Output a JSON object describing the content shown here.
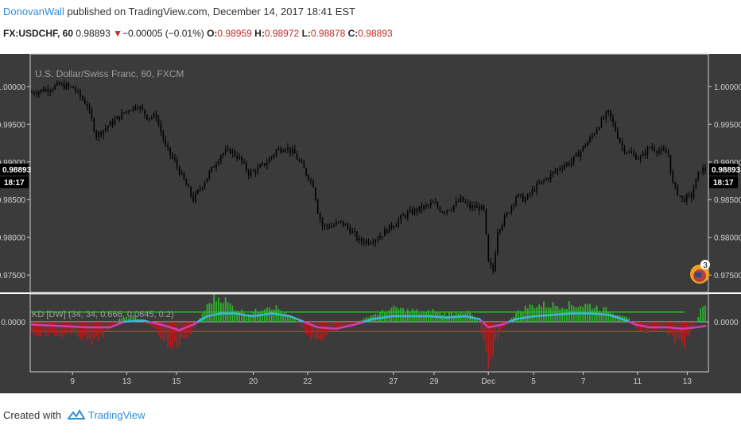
{
  "header": {
    "author": "DonovanWall",
    "published_text": " published on TradingView.com, December 14, 2017 18:41 EST"
  },
  "quote": {
    "symbol": "FX:USDCHF, 60",
    "last": "0.98893",
    "change": "−0.00005 (−0.01%)",
    "open_label": "O:",
    "open": "0.98959",
    "high_label": "H:",
    "high": "0.98972",
    "low_label": "L:",
    "low": "0.98878",
    "close_label": "C:",
    "close": "0.98893"
  },
  "colors": {
    "panel_bg": "#3b3b3b",
    "candle": "#000000",
    "histogram_pos": "#2db52d",
    "histogram_neg": "#b71c1c",
    "line_pos": "#3fb6d8",
    "line_neg": "#d63ab0",
    "upper_band": "#22c322",
    "lower_band": "#d32f2f",
    "price_tag_bg": "#000000",
    "brand": "#2f8fd8"
  },
  "footer": {
    "created_with": "Created with",
    "brand": "TradingView"
  },
  "chart_data": [
    {
      "type": "candlestick",
      "title": "U.S. Dollar/Swiss Franc, 60, FXCM",
      "yticks": [
        "1.00000",
        "0.99500",
        "0.99000",
        "0.98500",
        "0.98000",
        "0.97500"
      ],
      "ylim": [
        0.9727,
        1.0043
      ],
      "last_price_label": "0.98893",
      "countdown_label": "18:17",
      "badge_label": "3",
      "x_ticks": [
        "9",
        "13",
        "15",
        "20",
        "22",
        "27",
        "29",
        "Dec",
        "5",
        "7",
        "11",
        "13"
      ],
      "close_path": [
        [
          0,
          0.9992
        ],
        [
          3,
          0.9996
        ],
        [
          6,
          1.0002
        ],
        [
          9,
          0.9998
        ],
        [
          12,
          0.9975
        ],
        [
          14,
          0.9935
        ],
        [
          17,
          0.995
        ],
        [
          19,
          0.996
        ],
        [
          21,
          0.997
        ],
        [
          23,
          0.9975
        ],
        [
          25,
          0.996
        ],
        [
          27,
          0.996
        ],
        [
          29,
          0.992
        ],
        [
          31,
          0.99
        ],
        [
          33,
          0.9875
        ],
        [
          35,
          0.985
        ],
        [
          37,
          0.987
        ],
        [
          39,
          0.989
        ],
        [
          41,
          0.991
        ],
        [
          43,
          0.9915
        ],
        [
          45,
          0.9905
        ],
        [
          47,
          0.9885
        ],
        [
          49,
          0.989
        ],
        [
          51,
          0.99
        ],
        [
          53,
          0.9915
        ],
        [
          55,
          0.992
        ],
        [
          57,
          0.991
        ],
        [
          59,
          0.989
        ],
        [
          61,
          0.987
        ],
        [
          62,
          0.9835
        ],
        [
          63,
          0.9815
        ],
        [
          65,
          0.9815
        ],
        [
          67,
          0.982
        ],
        [
          69,
          0.981
        ],
        [
          71,
          0.9795
        ],
        [
          73,
          0.9795
        ],
        [
          75,
          0.98
        ],
        [
          77,
          0.981
        ],
        [
          79,
          0.982
        ],
        [
          81,
          0.983
        ],
        [
          83,
          0.9835
        ],
        [
          85,
          0.984
        ],
        [
          87,
          0.9845
        ],
        [
          89,
          0.9835
        ],
        [
          91,
          0.984
        ],
        [
          93,
          0.985
        ],
        [
          95,
          0.984
        ],
        [
          97,
          0.984
        ],
        [
          98,
          0.9835
        ],
        [
          99,
          0.9765
        ],
        [
          100,
          0.9755
        ],
        [
          101,
          0.981
        ],
        [
          103,
          0.983
        ],
        [
          105,
          0.9855
        ],
        [
          107,
          0.985
        ],
        [
          109,
          0.9865
        ],
        [
          111,
          0.9875
        ],
        [
          113,
          0.9885
        ],
        [
          115,
          0.9895
        ],
        [
          117,
          0.99
        ],
        [
          119,
          0.9915
        ],
        [
          121,
          0.993
        ],
        [
          123,
          0.995
        ],
        [
          125,
          0.9965
        ],
        [
          126,
          0.995
        ],
        [
          128,
          0.992
        ],
        [
          130,
          0.991
        ],
        [
          132,
          0.9905
        ],
        [
          134,
          0.992
        ],
        [
          136,
          0.9915
        ],
        [
          138,
          0.991
        ],
        [
          139,
          0.987
        ],
        [
          141,
          0.985
        ],
        [
          143,
          0.9855
        ],
        [
          144,
          0.9875
        ],
        [
          145,
          0.989
        ],
        [
          146,
          0.98893
        ]
      ]
    },
    {
      "type": "oscillator",
      "title": "KD [DW] (34, 34, 0.666, 0.0645, 0.2)",
      "yticks": [
        "0.0000"
      ],
      "ylim": [
        -0.18,
        0.1
      ],
      "upper_band": 0.035,
      "lower_band": -0.035,
      "histogram": [
        [
          0,
          -0.04
        ],
        [
          5,
          -0.05
        ],
        [
          10,
          -0.045
        ],
        [
          13,
          -0.08
        ],
        [
          16,
          -0.04
        ],
        [
          19,
          0.01
        ],
        [
          22,
          0.02
        ],
        [
          25,
          -0.01
        ],
        [
          27,
          -0.03
        ],
        [
          29,
          -0.08
        ],
        [
          31,
          -0.09
        ],
        [
          33,
          -0.06
        ],
        [
          35,
          -0.03
        ],
        [
          37,
          0.03
        ],
        [
          39,
          0.08
        ],
        [
          41,
          0.09
        ],
        [
          43,
          0.06
        ],
        [
          45,
          0.04
        ],
        [
          47,
          0.03
        ],
        [
          49,
          0.04
        ],
        [
          51,
          0.06
        ],
        [
          53,
          0.05
        ],
        [
          55,
          0.03
        ],
        [
          57,
          0.01
        ],
        [
          59,
          -0.03
        ],
        [
          61,
          -0.06
        ],
        [
          63,
          -0.06
        ],
        [
          65,
          -0.04
        ],
        [
          67,
          -0.02
        ],
        [
          69,
          -0.01
        ],
        [
          71,
          0.0
        ],
        [
          73,
          0.02
        ],
        [
          75,
          0.03
        ],
        [
          77,
          0.04
        ],
        [
          79,
          0.05
        ],
        [
          81,
          0.04
        ],
        [
          83,
          0.04
        ],
        [
          85,
          0.03
        ],
        [
          87,
          0.04
        ],
        [
          89,
          0.03
        ],
        [
          91,
          0.03
        ],
        [
          93,
          0.04
        ],
        [
          95,
          0.03
        ],
        [
          97,
          0.0
        ],
        [
          99,
          -0.14
        ],
        [
          101,
          -0.06
        ],
        [
          103,
          0.0
        ],
        [
          105,
          0.03
        ],
        [
          107,
          0.05
        ],
        [
          109,
          0.06
        ],
        [
          111,
          0.06
        ],
        [
          113,
          0.06
        ],
        [
          115,
          0.06
        ],
        [
          117,
          0.06
        ],
        [
          119,
          0.06
        ],
        [
          121,
          0.06
        ],
        [
          123,
          0.05
        ],
        [
          125,
          0.04
        ],
        [
          127,
          0.03
        ],
        [
          129,
          0.02
        ],
        [
          131,
          -0.02
        ],
        [
          133,
          -0.04
        ],
        [
          135,
          -0.03
        ],
        [
          137,
          -0.02
        ],
        [
          139,
          -0.06
        ],
        [
          141,
          -0.09
        ],
        [
          143,
          -0.04
        ],
        [
          145,
          0.04
        ],
        [
          146,
          0.06
        ]
      ],
      "signal": [
        [
          0,
          -0.01
        ],
        [
          6,
          -0.015
        ],
        [
          12,
          -0.02
        ],
        [
          17,
          -0.02
        ],
        [
          20,
          0.0
        ],
        [
          24,
          0.005
        ],
        [
          28,
          -0.01
        ],
        [
          32,
          -0.03
        ],
        [
          35,
          -0.01
        ],
        [
          38,
          0.02
        ],
        [
          41,
          0.03
        ],
        [
          44,
          0.03
        ],
        [
          48,
          0.02
        ],
        [
          52,
          0.03
        ],
        [
          56,
          0.02
        ],
        [
          59,
          0.0
        ],
        [
          62,
          -0.02
        ],
        [
          66,
          -0.025
        ],
        [
          70,
          -0.01
        ],
        [
          74,
          0.01
        ],
        [
          78,
          0.02
        ],
        [
          82,
          0.02
        ],
        [
          86,
          0.02
        ],
        [
          90,
          0.015
        ],
        [
          94,
          0.02
        ],
        [
          97,
          0.01
        ],
        [
          99,
          -0.02
        ],
        [
          102,
          -0.01
        ],
        [
          105,
          0.01
        ],
        [
          109,
          0.02
        ],
        [
          113,
          0.025
        ],
        [
          117,
          0.03
        ],
        [
          121,
          0.03
        ],
        [
          125,
          0.025
        ],
        [
          128,
          0.01
        ],
        [
          131,
          -0.01
        ],
        [
          134,
          -0.02
        ],
        [
          138,
          -0.02
        ],
        [
          141,
          -0.025
        ],
        [
          144,
          -0.02
        ],
        [
          146,
          -0.015
        ]
      ]
    }
  ]
}
